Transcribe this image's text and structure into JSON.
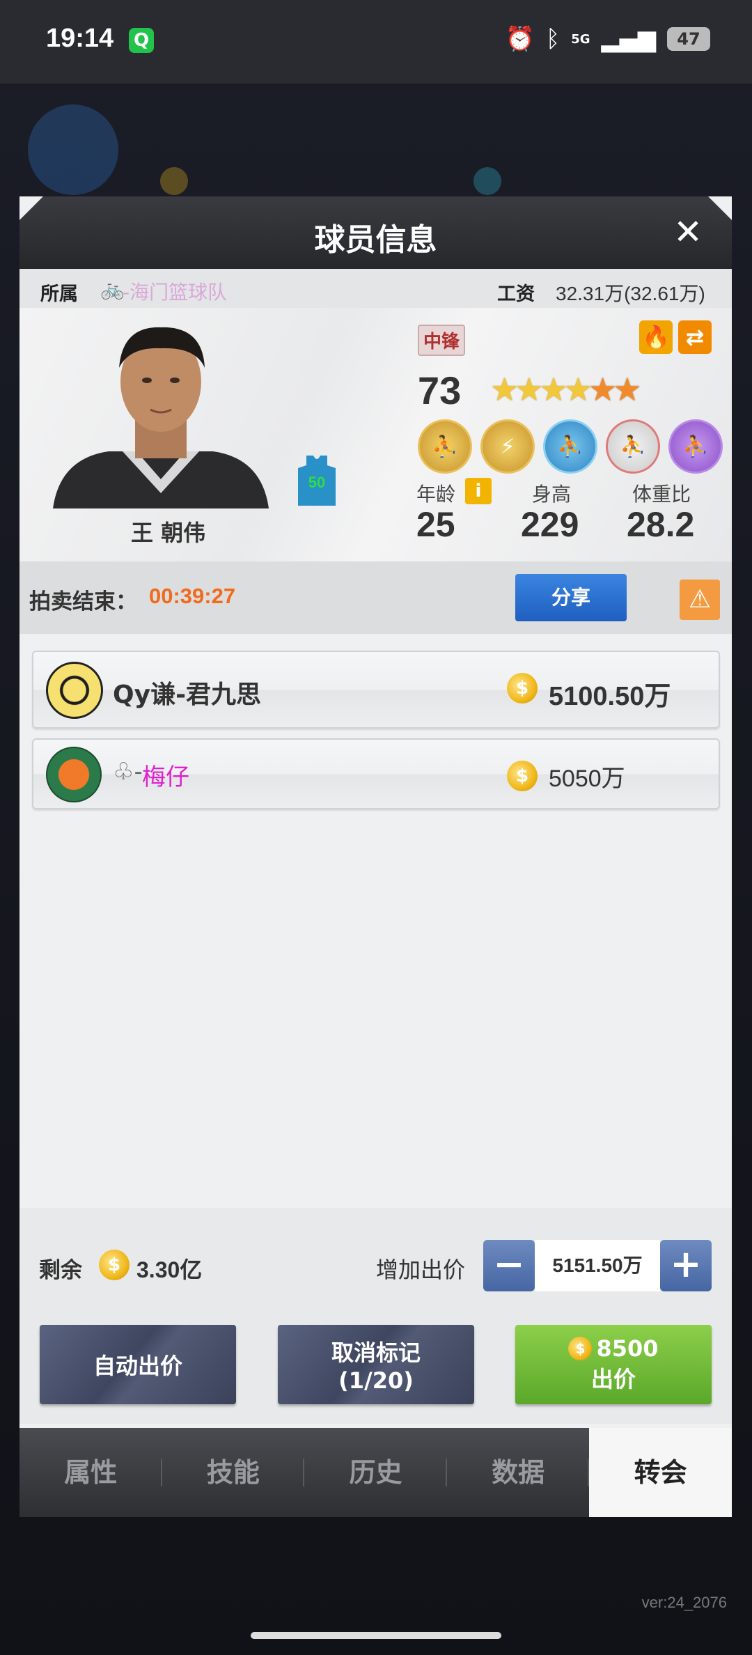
{
  "status_bar": {
    "time": "19:14",
    "app_badge": "Q",
    "network": "5G",
    "battery": "47"
  },
  "modal": {
    "title": "球员信息",
    "close_label": "✕"
  },
  "info": {
    "team_label": "所属",
    "team_name": "-海门篮球队",
    "salary_label": "工资",
    "salary_value": "32.31万(32.61万)"
  },
  "player": {
    "name": "王 朝伟",
    "position": "中锋",
    "jersey_number": "50",
    "rating": "73",
    "stars_gold": 4,
    "stars_orange": 2,
    "age_label": "年龄",
    "age": "25",
    "height_label": "身高",
    "height": "229",
    "weight_label": "体重比",
    "weight_ratio": "28.2"
  },
  "auction": {
    "end_label": "拍卖结束：",
    "countdown": "00:39:27",
    "share_label": "分享"
  },
  "bids": [
    {
      "bidder": "Qy谦-君九思",
      "amount": "5100.50万"
    },
    {
      "bidder_prefix": "♧-",
      "bidder": "梅仔",
      "amount": "5050万"
    }
  ],
  "controls": {
    "remaining_label": "剩余",
    "remaining_value": "3.30亿",
    "add_bid_label": "增加出价",
    "bid_input_value": "5151.50万",
    "auto_bid_label": "自动出价",
    "cancel_mark_label": "取消标记",
    "cancel_mark_count": "(1/20)",
    "bid_cost": "8500",
    "bid_label": "出价"
  },
  "tabs": [
    "属性",
    "技能",
    "历史",
    "数据",
    "转会"
  ],
  "active_tab": "转会",
  "footer": {
    "version": "ver:24_2076"
  },
  "colors": {
    "countdown": "#f26a1b",
    "share_button": "#2a6fd0",
    "bid_button": "#6cbb38",
    "position_badge": "#b03030",
    "second_bidder": "#e020d0"
  }
}
